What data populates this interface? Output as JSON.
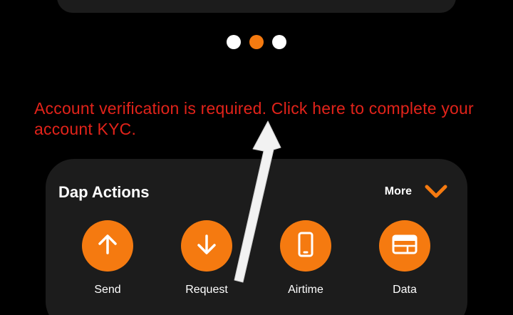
{
  "kyc_notice": "Account verification is required. Click here to complete your account KYC.",
  "carousel": {
    "dots": [
      {
        "active": false
      },
      {
        "active": true
      },
      {
        "active": false
      }
    ]
  },
  "dap_actions": {
    "title": "Dap Actions",
    "more_label": "More",
    "items": [
      {
        "label": "Send",
        "icon": "arrow-up-icon"
      },
      {
        "label": "Request",
        "icon": "arrow-down-icon"
      },
      {
        "label": "Airtime",
        "icon": "phone-icon"
      },
      {
        "label": "Data",
        "icon": "browser-card-icon"
      }
    ]
  },
  "colors": {
    "accent": "#f57a10",
    "warning_text": "#e2231a",
    "card_bg": "#1c1c1c",
    "background": "#000000"
  }
}
